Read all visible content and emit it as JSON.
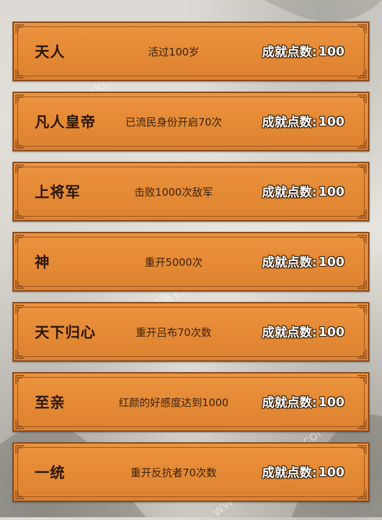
{
  "achievements": [
    {
      "name": "天人",
      "desc": "活过100岁",
      "points_label": "成就点数:",
      "points": "100"
    },
    {
      "name": "凡人皇帝",
      "desc": "已流民身份开启70次",
      "points_label": "成就点数:",
      "points": "100"
    },
    {
      "name": "上将军",
      "desc": "击败1000次敌军",
      "points_label": "成就点数:",
      "points": "100"
    },
    {
      "name": "神",
      "desc": "重开5000次",
      "points_label": "成就点数:",
      "points": "100"
    },
    {
      "name": "天下归心",
      "desc": "重开吕布70次数",
      "points_label": "成就点数:",
      "points": "100"
    },
    {
      "name": "至亲",
      "desc": "红颜的好感度达到1000",
      "points_label": "成就点数:",
      "points": "100"
    },
    {
      "name": "一统",
      "desc": "重开反抗者70次数",
      "points_label": "成就点数:",
      "points": "100"
    }
  ],
  "watermarks": {
    "top": "www.hackhome.com",
    "middle": "嗨客手机站",
    "bottom": "www.hackhome.com"
  },
  "colors": {
    "card_fill": "#e48934",
    "card_border": "#8a4a1c",
    "title_text": "#2a1608",
    "points_text": "#ffffff"
  }
}
